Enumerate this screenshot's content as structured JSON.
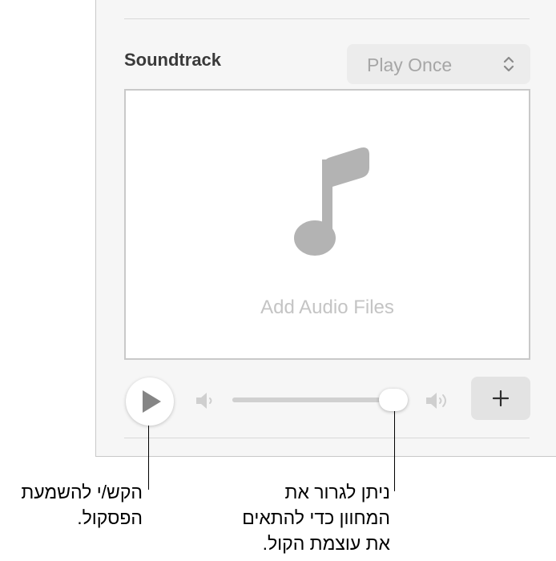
{
  "inspector": {
    "section_title": "Soundtrack",
    "playback_mode": {
      "selected": "Play Once"
    },
    "drop_zone": {
      "icon": "music-note-icon",
      "label": "Add Audio Files"
    },
    "controls": {
      "play_icon": "play-icon",
      "volume_low_icon": "speaker-low-icon",
      "volume_high_icon": "speaker-high-icon",
      "volume_level": 0.93,
      "add_icon": "plus-icon"
    }
  },
  "callouts": {
    "play": [
      "הקש/י להשמעת",
      "הפסקול."
    ],
    "slider": [
      "ניתן לגרור את",
      "המחוון כדי להתאים",
      "את עוצמת הקול."
    ]
  }
}
